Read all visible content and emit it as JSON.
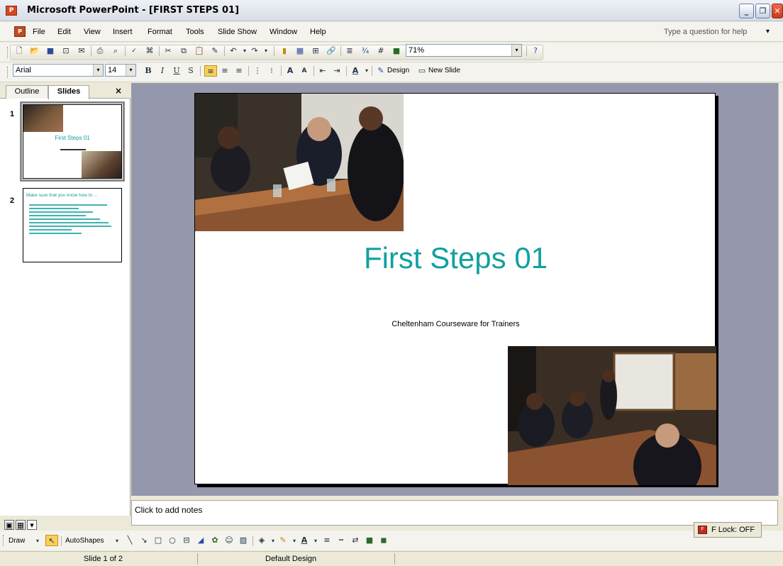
{
  "window": {
    "title": "Microsoft PowerPoint - [FIRST STEPS 01]",
    "app_icon": "powerpoint-icon",
    "buttons": {
      "minimize": "_",
      "maximize": "❐",
      "close": "✕"
    }
  },
  "menubar": {
    "items": [
      "File",
      "Edit",
      "View",
      "Insert",
      "Format",
      "Tools",
      "Slide Show",
      "Window",
      "Help"
    ],
    "help_placeholder": "Type a question for help"
  },
  "standard_toolbar": {
    "zoom": "71%"
  },
  "formatting_toolbar": {
    "font": "Arial",
    "size": "14",
    "bold": "B",
    "italic": "I",
    "underline": "U",
    "shadow": "S",
    "design_label": "Design",
    "new_slide_label": "New Slide"
  },
  "left_panel": {
    "tabs": [
      "Outline",
      "Slides"
    ],
    "active_tab": "Slides",
    "close": "×",
    "slides": [
      {
        "number": "1",
        "title": "First Steps 01"
      },
      {
        "number": "2",
        "title": "Make sure that you know how to ..."
      }
    ]
  },
  "slide": {
    "title": "First Steps 01",
    "subtitle": "Cheltenham Courseware for Trainers"
  },
  "notes": {
    "placeholder": "Click to add notes"
  },
  "drawing_toolbar": {
    "draw_label": "Draw",
    "autoshapes_label": "AutoShapes"
  },
  "flock": {
    "label": "F Lock: OFF"
  },
  "statusbar": {
    "slide_position": "Slide 1 of 2",
    "design": "Default Design"
  },
  "colors": {
    "title_accent": "#12a0a0",
    "edit_background": "#9597ad"
  }
}
